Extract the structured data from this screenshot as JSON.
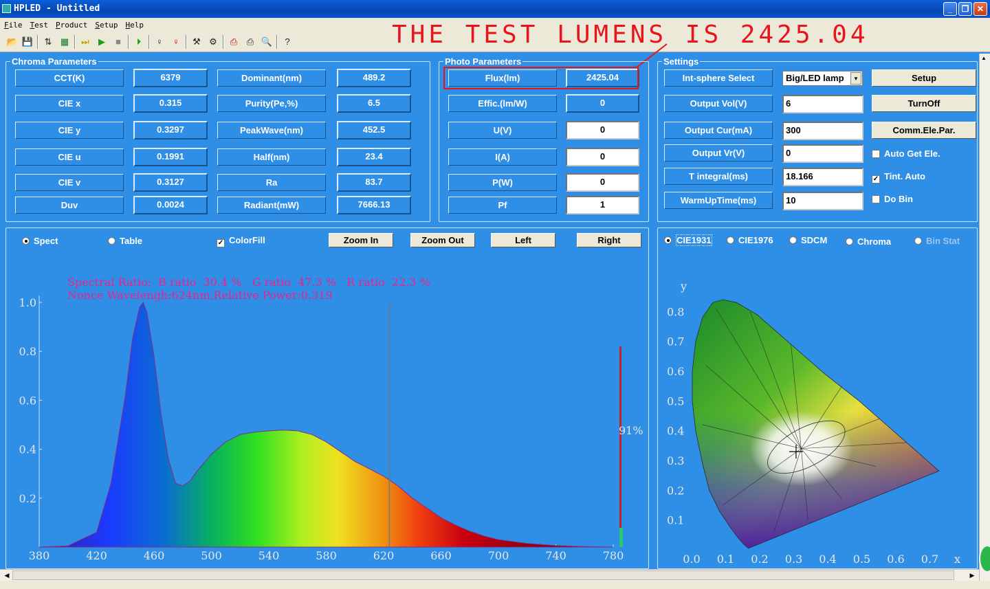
{
  "window": {
    "title": "HPLED - Untitled"
  },
  "menu": [
    "File",
    "Test",
    "Product",
    "Setup",
    "Help"
  ],
  "annotation": "THE TEST LUMENS IS 2425.04",
  "chroma": {
    "label": "Chroma Parameters",
    "rows": [
      {
        "l1": "CCT(K)",
        "v1": "6379",
        "l2": "Dominant(nm)",
        "v2": "489.2"
      },
      {
        "l1": "CIE x",
        "v1": "0.315",
        "l2": "Purity(Pe,%)",
        "v2": "6.5"
      },
      {
        "l1": "CIE y",
        "v1": "0.3297",
        "l2": "PeakWave(nm)",
        "v2": "452.5"
      },
      {
        "l1": "CIE u",
        "v1": "0.1991",
        "l2": "Half(nm)",
        "v2": "23.4"
      },
      {
        "l1": "CIE v",
        "v1": "0.3127",
        "l2": "Ra",
        "v2": "83.7"
      },
      {
        "l1": "Duv",
        "v1": "0.0024",
        "l2": "Radiant(mW)",
        "v2": "7666.13"
      }
    ]
  },
  "photo": {
    "label": "Photo Parameters",
    "rows": [
      {
        "l": "Flux(lm)",
        "v": "2425.04"
      },
      {
        "l": "Effic.(lm/W)",
        "v": "0"
      },
      {
        "l": "U(V)",
        "v": "0"
      },
      {
        "l": "I(A)",
        "v": "0"
      },
      {
        "l": "P(W)",
        "v": "0"
      },
      {
        "l": "Pf",
        "v": "1"
      }
    ]
  },
  "settings": {
    "label": "Settings",
    "int_sphere_label": "Int-sphere Select",
    "int_sphere_value": "Big/LED lamp",
    "output_vol_label": "Output Vol(V)",
    "output_vol": "6",
    "output_cur_label": "Output Cur(mA)",
    "output_cur": "300",
    "output_vr_label": "Output Vr(V)",
    "output_vr": "0",
    "t_integral_label": "T integral(ms)",
    "t_integral": "18.166",
    "warmup_label": "WarmUpTime(ms)",
    "warmup": "10",
    "setup_btn": "Setup",
    "turnoff_btn": "TurnOff",
    "comm_btn": "Comm.Ele.Par.",
    "auto_get": "Auto Get Ele.",
    "tint_auto": "Tint. Auto",
    "do_bin": "Do Bin"
  },
  "spect_controls": {
    "spect": "Spect",
    "table": "Table",
    "colorfill": "ColorFill",
    "zoom_in": "Zoom In",
    "zoom_out": "Zoom Out",
    "left": "Left",
    "right": "Right"
  },
  "cie_controls": {
    "cie1931": "CIE1931",
    "cie1976": "CIE1976",
    "sdcm": "SDCM",
    "chroma": "Chroma",
    "bin_stat": "Bin Stat"
  },
  "chart_data": [
    {
      "type": "area",
      "annotation_1": "Spectral Ratio:  B ratio  30.4 %   G ratio  47.3 %   R ratio  22.3 %",
      "annotation_2": "Nonce Wavelengh:624nm,Relative Power:0.319",
      "xlim": [
        380,
        780
      ],
      "ylim": [
        0,
        1.0
      ],
      "x_ticks": [
        380,
        420,
        460,
        500,
        540,
        580,
        620,
        660,
        700,
        740,
        780
      ],
      "y_ticks": [
        "1.0",
        "0.8",
        "0.6",
        "0.4",
        "0.2"
      ],
      "x": [
        380,
        400,
        420,
        430,
        440,
        445,
        450,
        452.5,
        455,
        460,
        465,
        470,
        475,
        480,
        485,
        490,
        500,
        510,
        520,
        530,
        540,
        550,
        560,
        570,
        580,
        590,
        600,
        610,
        620,
        630,
        640,
        650,
        660,
        670,
        680,
        690,
        700,
        720,
        740,
        760,
        780
      ],
      "y": [
        0,
        0.005,
        0.06,
        0.26,
        0.62,
        0.85,
        0.98,
        1.0,
        0.96,
        0.78,
        0.54,
        0.36,
        0.26,
        0.25,
        0.27,
        0.31,
        0.38,
        0.43,
        0.46,
        0.47,
        0.475,
        0.478,
        0.475,
        0.46,
        0.43,
        0.39,
        0.35,
        0.32,
        0.29,
        0.25,
        0.2,
        0.16,
        0.12,
        0.09,
        0.065,
        0.045,
        0.03,
        0.015,
        0.006,
        0.002,
        0
      ],
      "marker_wavelength": 624,
      "bar_label": "91%",
      "bar_level": 0.91
    },
    {
      "type": "scatter",
      "xlabel": "x",
      "ylabel": "y",
      "x_ticks": [
        "0.0",
        "0.1",
        "0.2",
        "0.3",
        "0.4",
        "0.5",
        "0.6",
        "0.7"
      ],
      "y_ticks": [
        "0.8",
        "0.7",
        "0.6",
        "0.5",
        "0.4",
        "0.3",
        "0.2",
        "0.1"
      ],
      "xlim": [
        0,
        0.8
      ],
      "ylim": [
        0,
        0.9
      ],
      "point": {
        "x": 0.315,
        "y": 0.3297
      }
    }
  ]
}
